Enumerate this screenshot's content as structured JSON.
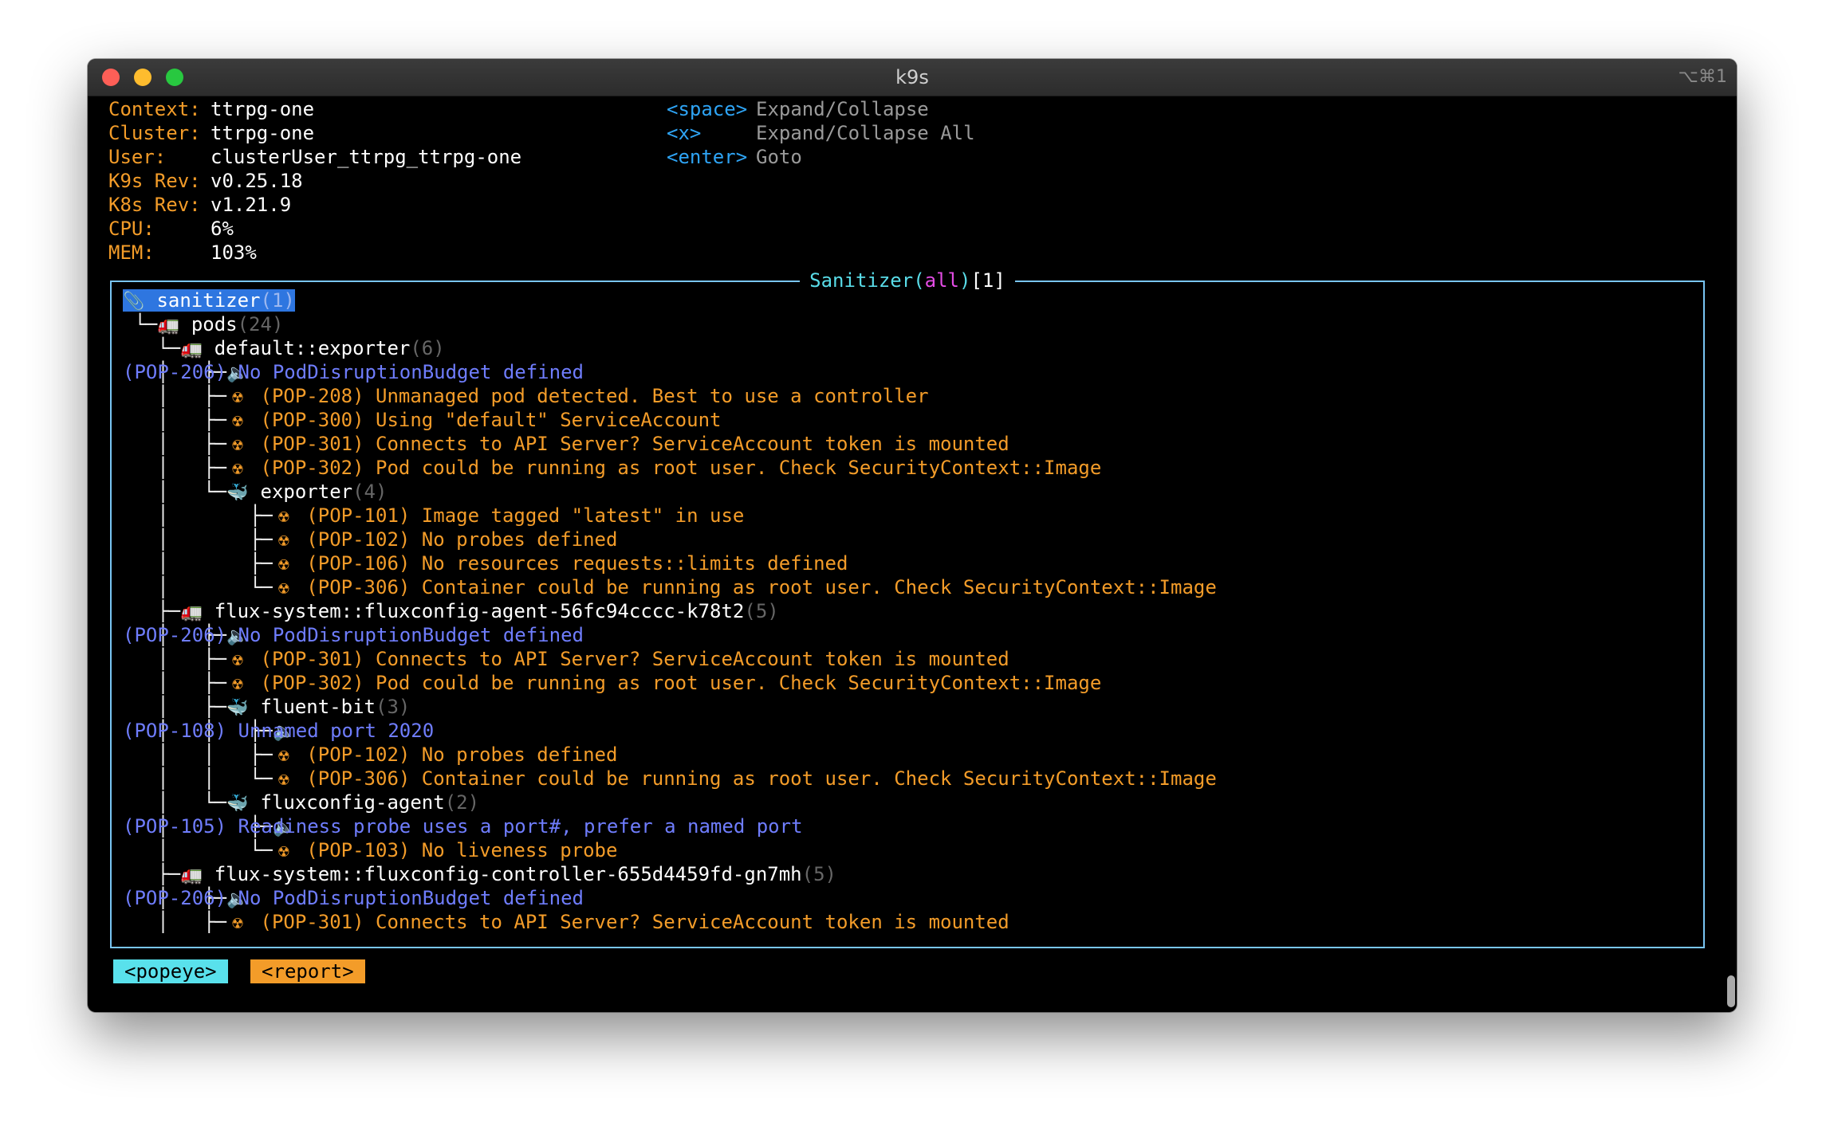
{
  "window": {
    "title": "k9s",
    "shortcut": "⌥⌘1"
  },
  "info": [
    {
      "label": "Context:",
      "value": "ttrpg-one"
    },
    {
      "label": "Cluster:",
      "value": "ttrpg-one"
    },
    {
      "label": "User:",
      "value": "clusterUser_ttrpg_ttrpg-one"
    },
    {
      "label": "K9s Rev:",
      "value": "v0.25.18"
    },
    {
      "label": "K8s Rev:",
      "value": "v1.21.9"
    },
    {
      "label": "CPU:",
      "value": "6%"
    },
    {
      "label": "MEM:",
      "value": "103%"
    }
  ],
  "keys": [
    {
      "key": "<space>",
      "desc": "Expand/Collapse"
    },
    {
      "key": "<x>",
      "desc": "Expand/Collapse All"
    },
    {
      "key": "<enter>",
      "desc": "Goto"
    }
  ],
  "panel": {
    "name": "Sanitizer",
    "scope": "all",
    "count": "[1]"
  },
  "tree": [
    {
      "prefix": "",
      "icon": "paperclip-icon",
      "glyph": "📎",
      "name": "sanitizer",
      "count": "(1)",
      "selected": true
    },
    {
      "prefix": " └─",
      "icon": "truck-icon",
      "glyph": "🚛",
      "name": "pods",
      "count": "(24)"
    },
    {
      "prefix": "   └─",
      "icon": "truck-icon",
      "glyph": "🚛",
      "name": "default::exporter",
      "count": "(6)"
    },
    {
      "prefix": "   │   ├─",
      "icon": "speaker-icon",
      "glyph": "🔈",
      "code": "(POP-206)",
      "text": "No PodDisruptionBudget defined",
      "level": "info"
    },
    {
      "prefix": "   │   ├─",
      "icon": "radioactive-icon",
      "glyph": "☢",
      "code": "(POP-208)",
      "text": "Unmanaged pod detected. Best to use a controller",
      "level": "warn"
    },
    {
      "prefix": "   │   ├─",
      "icon": "radioactive-icon",
      "glyph": "☢",
      "code": "(POP-300)",
      "text": "Using \"default\" ServiceAccount",
      "level": "warn"
    },
    {
      "prefix": "   │   ├─",
      "icon": "radioactive-icon",
      "glyph": "☢",
      "code": "(POP-301)",
      "text": "Connects to API Server? ServiceAccount token is mounted",
      "level": "warn"
    },
    {
      "prefix": "   │   ├─",
      "icon": "radioactive-icon",
      "glyph": "☢",
      "code": "(POP-302)",
      "text": "Pod could be running as root user. Check SecurityContext::Image",
      "level": "warn"
    },
    {
      "prefix": "   │   └─",
      "icon": "whale-icon",
      "glyph": "🐳",
      "name": "exporter",
      "count": "(4)"
    },
    {
      "prefix": "   │       ├─",
      "icon": "radioactive-icon",
      "glyph": "☢",
      "code": "(POP-101)",
      "text": "Image tagged \"latest\" in use",
      "level": "warn"
    },
    {
      "prefix": "   │       ├─",
      "icon": "radioactive-icon",
      "glyph": "☢",
      "code": "(POP-102)",
      "text": "No probes defined",
      "level": "warn"
    },
    {
      "prefix": "   │       ├─",
      "icon": "radioactive-icon",
      "glyph": "☢",
      "code": "(POP-106)",
      "text": "No resources requests::limits defined",
      "level": "warn"
    },
    {
      "prefix": "   │       └─",
      "icon": "radioactive-icon",
      "glyph": "☢",
      "code": "(POP-306)",
      "text": "Container could be running as root user. Check SecurityContext::Image",
      "level": "warn"
    },
    {
      "prefix": "   ├─",
      "icon": "truck-icon",
      "glyph": "🚛",
      "name": "flux-system::fluxconfig-agent-56fc94cccc-k78t2",
      "count": "(5)"
    },
    {
      "prefix": "   │   ├─",
      "icon": "speaker-icon",
      "glyph": "🔈",
      "code": "(POP-206)",
      "text": "No PodDisruptionBudget defined",
      "level": "info"
    },
    {
      "prefix": "   │   ├─",
      "icon": "radioactive-icon",
      "glyph": "☢",
      "code": "(POP-301)",
      "text": "Connects to API Server? ServiceAccount token is mounted",
      "level": "warn"
    },
    {
      "prefix": "   │   ├─",
      "icon": "radioactive-icon",
      "glyph": "☢",
      "code": "(POP-302)",
      "text": "Pod could be running as root user. Check SecurityContext::Image",
      "level": "warn"
    },
    {
      "prefix": "   │   ├─",
      "icon": "whale-icon",
      "glyph": "🐳",
      "name": "fluent-bit",
      "count": "(3)"
    },
    {
      "prefix": "   │   │   ├─",
      "icon": "speaker-icon",
      "glyph": "🔈",
      "code": "(POP-108)",
      "text": "Unnamed port 2020",
      "level": "info"
    },
    {
      "prefix": "   │   │   ├─",
      "icon": "radioactive-icon",
      "glyph": "☢",
      "code": "(POP-102)",
      "text": "No probes defined",
      "level": "warn"
    },
    {
      "prefix": "   │   │   └─",
      "icon": "radioactive-icon",
      "glyph": "☢",
      "code": "(POP-306)",
      "text": "Container could be running as root user. Check SecurityContext::Image",
      "level": "warn"
    },
    {
      "prefix": "   │   └─",
      "icon": "whale-icon",
      "glyph": "🐳",
      "name": "fluxconfig-agent",
      "count": "(2)"
    },
    {
      "prefix": "   │       ├─",
      "icon": "speaker-icon",
      "glyph": "🔈",
      "code": "(POP-105)",
      "text": "Readiness probe uses a port#, prefer a named port",
      "level": "info"
    },
    {
      "prefix": "   │       └─",
      "icon": "radioactive-icon",
      "glyph": "☢",
      "code": "(POP-103)",
      "text": "No liveness probe",
      "level": "warn"
    },
    {
      "prefix": "   ├─",
      "icon": "truck-icon",
      "glyph": "🚛",
      "name": "flux-system::fluxconfig-controller-655d4459fd-gn7mh",
      "count": "(5)"
    },
    {
      "prefix": "   │   ├─",
      "icon": "speaker-icon",
      "glyph": "🔈",
      "code": "(POP-206)",
      "text": "No PodDisruptionBudget defined",
      "level": "info"
    },
    {
      "prefix": "   │   ├─",
      "icon": "radioactive-icon",
      "glyph": "☢",
      "code": "(POP-301)",
      "text": "Connects to API Server? ServiceAccount token is mounted",
      "level": "warn"
    }
  ],
  "footer": {
    "crumbs": [
      "<popeye>",
      "<report>"
    ]
  }
}
